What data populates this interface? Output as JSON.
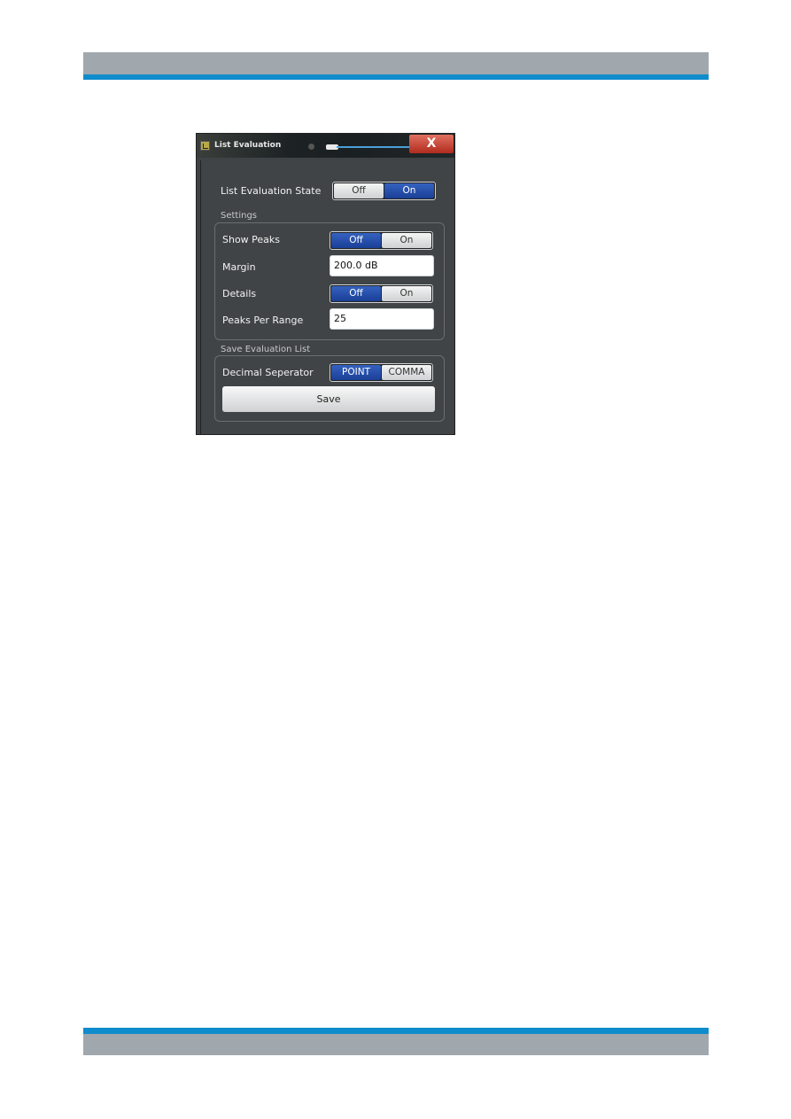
{
  "dialog": {
    "title": "List Evaluation",
    "close_label": "X",
    "list_evaluation_state": {
      "label": "List Evaluation State",
      "options": [
        "Off",
        "On"
      ],
      "selected": "On"
    },
    "settings": {
      "section_label": "Settings",
      "show_peaks": {
        "label": "Show Peaks",
        "options": [
          "Off",
          "On"
        ],
        "selected": "Off"
      },
      "margin": {
        "label": "Margin",
        "value": "200.0 dB"
      },
      "details": {
        "label": "Details",
        "options": [
          "Off",
          "On"
        ],
        "selected": "Off"
      },
      "peaks_per_range": {
        "label": "Peaks Per Range",
        "value": "25"
      }
    },
    "save_evaluation_list": {
      "section_label": "Save Evaluation List",
      "decimal_separator": {
        "label": "Decimal Seperator",
        "options": [
          "POINT",
          "COMMA"
        ],
        "selected": "POINT"
      },
      "save_label": "Save"
    }
  },
  "colors": {
    "accent_blue": "#0f8ccc",
    "band_gray": "#a0a7ad",
    "toggle_on": "#1a3f96",
    "close_red": "#c0392b"
  }
}
